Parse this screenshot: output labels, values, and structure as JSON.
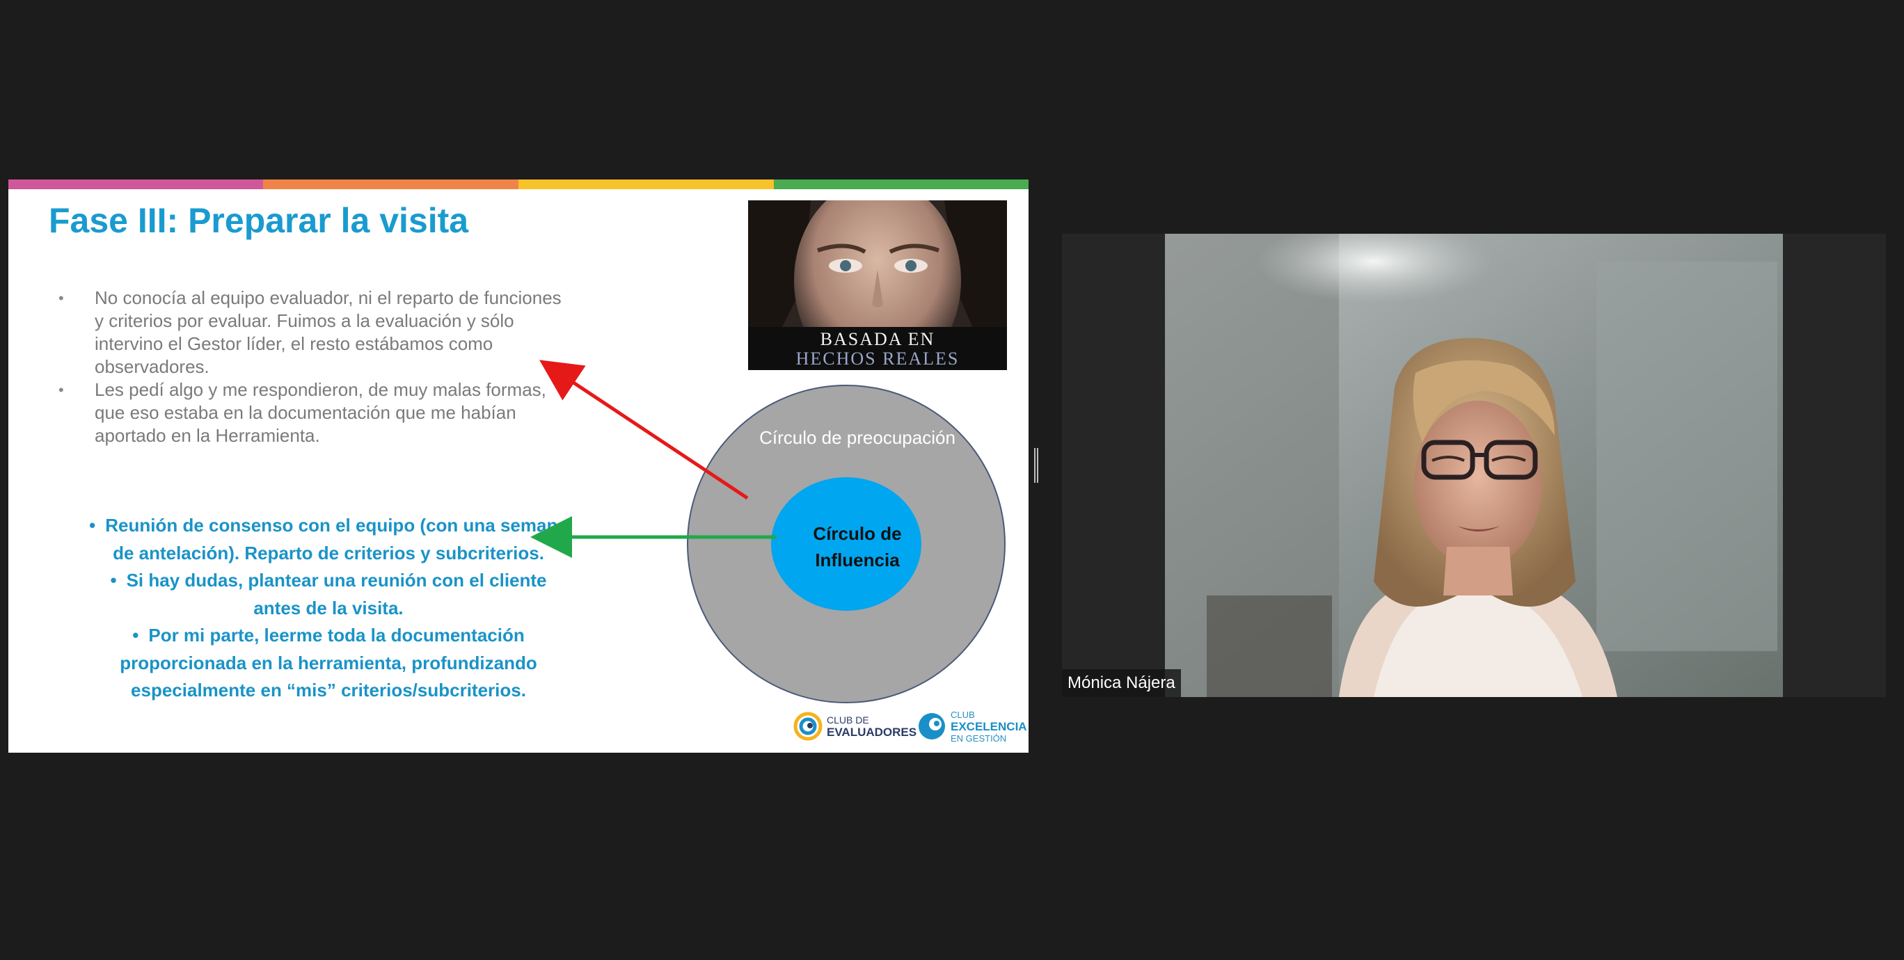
{
  "slide": {
    "title": "Fase III: Preparar la visita",
    "stripe_colors": [
      "#d0589a",
      "#f08448",
      "#f7c22a",
      "#4aab50"
    ],
    "gray_bullets": [
      "No conocía al equipo evaluador, ni el reparto de funciones y criterios por evaluar. Fuimos a la evaluación y sólo intervino el Gestor líder, el resto estábamos como observadores.",
      "Les pedí algo y me respondieron, de muy malas formas, que eso estaba en la documentación que me habían aportado en la Herramienta."
    ],
    "blue_bullets": [
      "Reunión de consenso con el equipo (con una semana de antelación). Reparto de criterios y subcriterios.",
      "Si hay dudas, plantear una reunión con el cliente antes de la visita.",
      "Por mi parte, leerme toda la documentación proporcionada en la herramienta, profundizando especialmente en “mis” criterios/subcriterios."
    ],
    "poster": {
      "line1": "BASADA EN",
      "line2": "HECHOS REALES"
    },
    "diagram": {
      "outer_label": "Círculo de preocupación",
      "inner_label_line1": "Círculo de",
      "inner_label_line2": "Influencia",
      "outer_color": "#a6a6a6",
      "inner_color": "#00a6f0",
      "arrow_red": "#e61919",
      "arrow_green": "#21a84a"
    },
    "logos": {
      "evaluadores_line1": "CLUB DE",
      "evaluadores_line2": "EVALUADORES",
      "excelencia_line1": "CLUB",
      "excelencia_line2": "EXCELENCIA",
      "excelencia_line3": "EN GESTIÓN"
    }
  },
  "video": {
    "participant_name": "Mónica Nájera"
  }
}
